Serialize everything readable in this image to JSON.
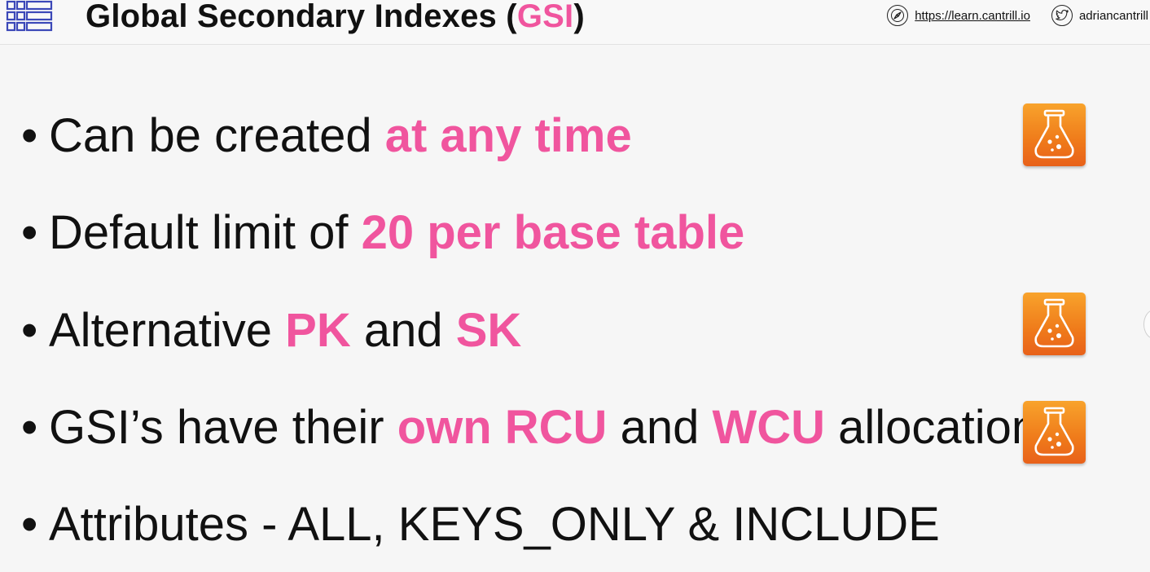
{
  "header": {
    "title_main": "Global Secondary Indexes (",
    "title_accent": "GSI",
    "title_end": ")",
    "website_url": "https://learn.cantrill.io",
    "twitter_handle": "adriancantrill",
    "icons": [
      "table-grid-icon",
      "compass-icon",
      "twitter-bird-icon"
    ]
  },
  "bullets": [
    {
      "dot": "•",
      "parts": [
        {
          "t": "Can be created "
        },
        {
          "t": "at any time",
          "em": true
        }
      ]
    },
    {
      "dot": "•",
      "parts": [
        {
          "t": "Default limit of "
        },
        {
          "t": "20 per base table",
          "em": true
        }
      ]
    },
    {
      "dot": "•",
      "parts": [
        {
          "t": "Alternative "
        },
        {
          "t": "PK",
          "em": true
        },
        {
          "t": " and "
        },
        {
          "t": "SK",
          "em": true
        }
      ]
    },
    {
      "dot": "•",
      "parts": [
        {
          "t": "GSI’s have their "
        },
        {
          "t": "own RCU",
          "em": true
        },
        {
          "t": " and "
        },
        {
          "t": "WCU",
          "em": true
        },
        {
          "t": " allocations"
        }
      ]
    },
    {
      "dot": "•",
      "parts": [
        {
          "t": "Attributes - ALL, KEYS_ONLY & INCLUDE"
        }
      ]
    }
  ],
  "lab_icons": [
    {
      "name": "lab-flask-icon",
      "row": 0
    },
    {
      "name": "lab-flask-icon",
      "row": 2
    },
    {
      "name": "lab-flask-icon",
      "row": 3
    }
  ],
  "colors": {
    "accent": "#f0559e",
    "text": "#111111",
    "background": "#f6f6f6",
    "lab_icon_top": "#f8a32c",
    "lab_icon_bottom": "#e8611a",
    "table_icon": "#3b48b8"
  }
}
